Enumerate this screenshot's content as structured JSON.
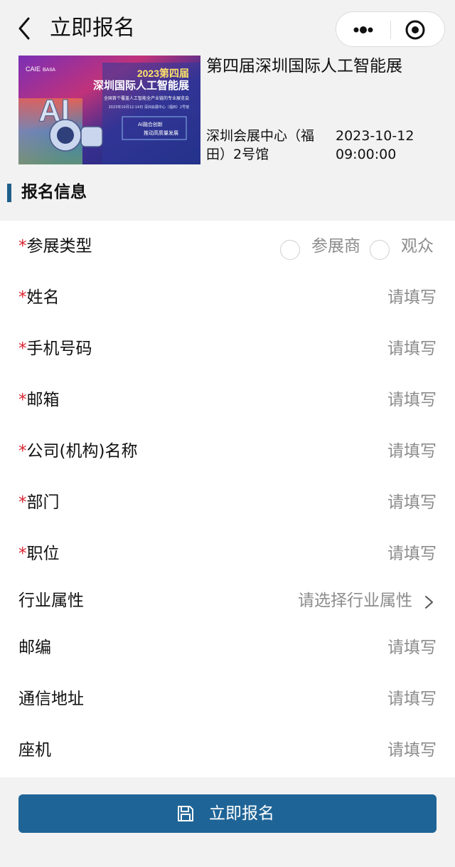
{
  "nav": {
    "back_icon": "chevron-left-icon",
    "title": "立即报名",
    "more_icon": "more-dots-icon",
    "close_icon": "target-close-icon"
  },
  "event": {
    "poster": {
      "year_title": "2023第四届",
      "main_title": "深圳国际人工智能展",
      "subtitle": "全国首个覆盖人工智能全产业链的专业展览会",
      "date_venue": "2023年10月12-14日  深圳会展中心（福田）2号馆",
      "slogan_1": "AI融合创新",
      "slogan_2": "推动高质量发展",
      "logo_1": "CAIE",
      "logo_2": "BAIIA",
      "hero_letters": "AI"
    },
    "title": "第四届深圳国际人工智能展",
    "location": "深圳会展中心（福田）2号馆",
    "datetime": "2023-10-12 09:00:00"
  },
  "section": {
    "title": "报名信息"
  },
  "form": {
    "required_mark": "*",
    "fields": [
      {
        "label": "参展类型",
        "required": true,
        "type": "radio",
        "options": [
          "参展商",
          "观众"
        ]
      },
      {
        "label": "姓名",
        "required": true,
        "placeholder": "请填写"
      },
      {
        "label": "手机号码",
        "required": true,
        "placeholder": "请填写"
      },
      {
        "label": "邮箱",
        "required": true,
        "placeholder": "请填写"
      },
      {
        "label": "公司(机构)名称",
        "required": true,
        "placeholder": "请填写"
      },
      {
        "label": "部门",
        "required": true,
        "placeholder": "请填写"
      },
      {
        "label": "职位",
        "required": true,
        "placeholder": "请填写"
      },
      {
        "label": "行业属性",
        "required": false,
        "type": "select",
        "placeholder": "请选择行业属性"
      },
      {
        "label": "邮编",
        "required": false,
        "placeholder": "请填写"
      },
      {
        "label": "通信地址",
        "required": false,
        "placeholder": "请填写"
      },
      {
        "label": "座机",
        "required": false,
        "placeholder": "请填写"
      }
    ]
  },
  "submit": {
    "icon": "save-icon",
    "label": "立即报名"
  },
  "colors": {
    "accent": "#1f6496",
    "section_bar": "#1f5f8b",
    "required": "#d9232e",
    "placeholder": "#8c8c8c",
    "background": "#f2f2f2"
  }
}
